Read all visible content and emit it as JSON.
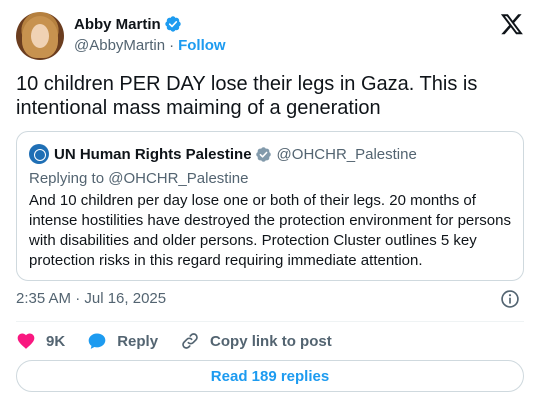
{
  "author": {
    "name": "Abby Martin",
    "handle": "@AbbyMartin",
    "separator": "·",
    "follow_label": "Follow"
  },
  "tweet": {
    "text": "10 children PER DAY lose their legs in Gaza. This is intentional mass maiming of a generation",
    "timestamp": "2:35 AM · Jul 16, 2025"
  },
  "quote": {
    "name": "UN Human Rights Palestine",
    "handle": "@OHCHR_Palestine",
    "replying_to": "Replying to @OHCHR_Palestine",
    "text": "And 10 children per day lose one or both of their legs. 20 months of intense hostilities have destroyed the protection environment for persons with disabilities and older persons. Protection Cluster outlines 5 key protection risks in this regard requiring immediate attention."
  },
  "actions": {
    "likes": "9K",
    "reply_label": "Reply",
    "copy_label": "Copy link to post"
  },
  "read_replies_label": "Read 189 replies",
  "colors": {
    "brand_blue": "#1d9bf0",
    "like_red": "#f91880",
    "muted": "#536471",
    "border": "#cfd9de",
    "verified_gray": "#829aab"
  },
  "icons": [
    "x-logo-icon",
    "verified-badge-icon",
    "verified-gray-badge-icon",
    "info-icon",
    "heart-icon",
    "reply-bubble-icon",
    "link-icon"
  ]
}
